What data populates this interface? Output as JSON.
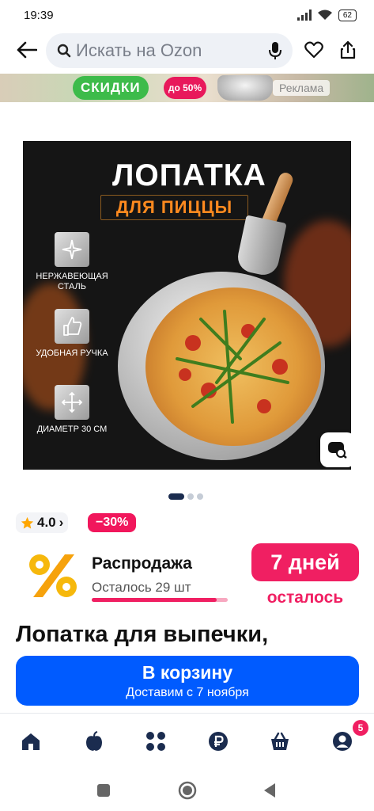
{
  "status": {
    "time": "19:39",
    "battery": "62",
    "icons": [
      "signal-icon",
      "wifi-icon",
      "battery-icon"
    ]
  },
  "topbar": {
    "search_placeholder": "Искать на Ozon",
    "icons": [
      "back-arrow-icon",
      "search-icon",
      "mic-icon",
      "heart-icon",
      "share-icon"
    ]
  },
  "banner": {
    "label": "СКИДКИ",
    "discount": "до 50%",
    "ad_label": "Реклама"
  },
  "product_image": {
    "title": "ЛОПАТКА",
    "subtitle": "ДЛЯ ПИЦЦЫ",
    "features": [
      {
        "label": "НЕРЖАВЕЮЩАЯ СТАЛЬ",
        "icon": "sparkle-icon"
      },
      {
        "label": "УДОБНАЯ РУЧКА",
        "icon": "thumbs-up-icon"
      },
      {
        "label": "ДИАМЕТР 30 СМ",
        "icon": "arrows-icon"
      }
    ],
    "image_count": 3,
    "active_index": 0
  },
  "rating": {
    "value": "4.0",
    "chevron": "›"
  },
  "discount_badge": "−30%",
  "promo": {
    "title": "Распродажа",
    "remaining": "Осталось 29 шт",
    "stock_fill": 0.92,
    "days_label": "7 дней",
    "days_suffix": "осталось"
  },
  "product_name": "Лопатка для выпечки,",
  "cart_button": {
    "label": "В корзину",
    "delivery": "Доставим с 7 ноября"
  },
  "bottom_nav": {
    "items": [
      "home-icon",
      "fresh-icon",
      "catalog-icon",
      "finance-icon",
      "cart-icon",
      "profile-icon"
    ],
    "profile_badge": "5"
  },
  "colors": {
    "accent": "#005bff",
    "sale": "#f01f62",
    "brand_green": "#3dbb4a"
  }
}
